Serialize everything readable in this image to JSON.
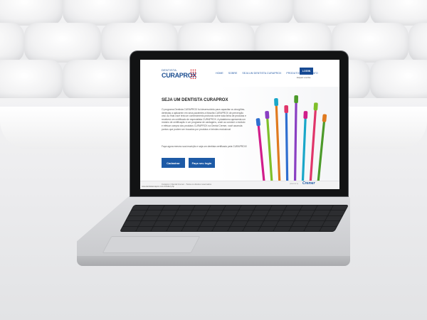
{
  "site": {
    "logo_small": "DENTISTA",
    "logo_big": "CURAPROX",
    "nav": [
      "HOME",
      "SOBRE",
      "SEJA UM DENTISTA CURAPROX",
      "PRODUTOS",
      "CONTATO"
    ],
    "login_label": "LOGIN",
    "forgot_label": "Esqueci a senha",
    "hero": {
      "title": "SEJA UM DENTISTA CURAPROX",
      "body": "O programa Dentista CURAPROX foi desenvolvido para capacitar os cirurgiões-dentistas a aplicarem em seus pacientes a filosofia CURAPROX de prevenção oral. Ao final você terá um conhecimento profundo sobre toda linha de produtos e receberá um certificado de especialista CURAPROX. A plataforma apresenta um módulo de certificação e um programa de vantagens, onde ao concluir o módulo e efetuar compra dos produtos CURAPROX na Dental Cremer, você acumula pontos que podem ser trocados por produtos e brindes exclusivos!",
      "cta_text": "Faça agora mesmo sua inscrição e seja um dentista certificado pela CURAPROX!",
      "btn_register": "Cadastrar",
      "btn_login": "Faça seu login"
    },
    "footer": {
      "copyright": "Curaprox | Dental Cremer - Todos os direitos reservados",
      "by": "powered by",
      "brand": "Cremer"
    },
    "status_url": "www.dentistacuraprox.com.br/index.php"
  },
  "brush_colors": [
    "#d11e8b",
    "#7fbf2a",
    "#e07a1f",
    "#2f6fd0",
    "#8a3fc2",
    "#1aa7c9",
    "#e0356a",
    "#4c9a2a"
  ]
}
